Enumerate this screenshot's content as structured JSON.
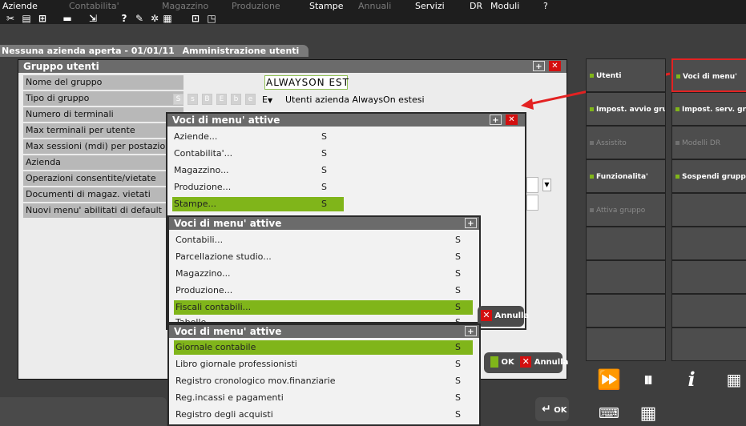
{
  "menu": [
    {
      "label": "Aziende",
      "enabled": true
    },
    {
      "label": "Contabilita'",
      "enabled": false
    },
    {
      "label": "Magazzino",
      "enabled": false
    },
    {
      "label": "Produzione",
      "enabled": false
    },
    {
      "label": "Stampe",
      "enabled": true
    },
    {
      "label": "Annuali",
      "enabled": false
    },
    {
      "label": "Servizi",
      "enabled": true
    },
    {
      "label": "DR",
      "enabled": true
    },
    {
      "label": "Moduli",
      "enabled": true
    },
    {
      "label": "?",
      "enabled": true
    }
  ],
  "toolbar_icons": [
    "scissors-icon",
    "document-icon",
    "stamp-icon",
    "printer-icon",
    "export-icon",
    "help-icon",
    "tools-icon",
    "settings-icon",
    "calculator-icon",
    "maximize-icon",
    "window-icon"
  ],
  "status": {
    "company": "Nessuna azienda aperta - 01/01/11",
    "module": "Amministrazione utenti"
  },
  "window": {
    "title": "Gruppo utenti",
    "fields": [
      "Nome del gruppo",
      "Tipo di gruppo",
      "Numero di terminali",
      "Max terminali per utente",
      "Max sessioni (mdi) per postazione",
      "Azienda",
      "Operazioni consentite/vietate",
      "Documenti di magaz. vietati",
      "Nuovi menu' abilitati di default"
    ],
    "group_name": "ALWAYSON EST",
    "type_letters": [
      "S",
      "s",
      "B",
      "E",
      "b",
      "e"
    ],
    "type_selected": "E",
    "type_description": "Utenti azienda AlwaysOn estesi"
  },
  "popups": [
    {
      "title": "Voci di menu' attive",
      "items": [
        {
          "label": "Aziende...",
          "value": "S"
        },
        {
          "label": "Contabilita'...",
          "value": "S"
        },
        {
          "label": "Magazzino...",
          "value": "S"
        },
        {
          "label": "Produzione...",
          "value": "S"
        },
        {
          "label": "Stampe...",
          "value": "S"
        }
      ],
      "highlight": 4
    },
    {
      "title": "Voci di menu' attive",
      "items": [
        {
          "label": "Contabili...",
          "value": "S"
        },
        {
          "label": "Parcellazione studio...",
          "value": "S"
        },
        {
          "label": "Magazzino...",
          "value": "S"
        },
        {
          "label": "Produzione...",
          "value": "S"
        },
        {
          "label": "Fiscali contabili...",
          "value": "S"
        },
        {
          "label": "Tabelle",
          "value": "S"
        }
      ],
      "highlight": 4
    },
    {
      "title": "Voci di menu' attive",
      "items": [
        {
          "label": "Giornale contabile",
          "value": "S"
        },
        {
          "label": "Libro giornale professionisti",
          "value": "S"
        },
        {
          "label": "Registro cronologico mov.finanziarie",
          "value": "S"
        },
        {
          "label": "Reg.incassi e pagamenti",
          "value": "S"
        },
        {
          "label": "Registro degli acquisti",
          "value": "S"
        }
      ],
      "highlight": 0
    }
  ],
  "buttons": {
    "ok": "OK",
    "annulla": "Annulla"
  },
  "side_buttons": [
    {
      "label": "Utenti",
      "enabled": true,
      "selected": false
    },
    {
      "label": "Voci di menu'",
      "enabled": true,
      "selected": true
    },
    {
      "label": "Impost. avvio gruppo",
      "enabled": true,
      "selected": false
    },
    {
      "label": "Impost. serv. gruppo",
      "enabled": true,
      "selected": false
    },
    {
      "label": "Assistito",
      "enabled": false,
      "selected": false
    },
    {
      "label": "Modelli DR",
      "enabled": false,
      "selected": false
    },
    {
      "label": "Funzionalita'",
      "enabled": true,
      "selected": false
    },
    {
      "label": "Sospendi gruppo",
      "enabled": true,
      "selected": false
    },
    {
      "label": "Attiva gruppo",
      "enabled": false,
      "selected": false
    }
  ],
  "colors": {
    "accent": "#80b51a",
    "close": "#d30f0f",
    "highlight_border": "#e32222"
  }
}
